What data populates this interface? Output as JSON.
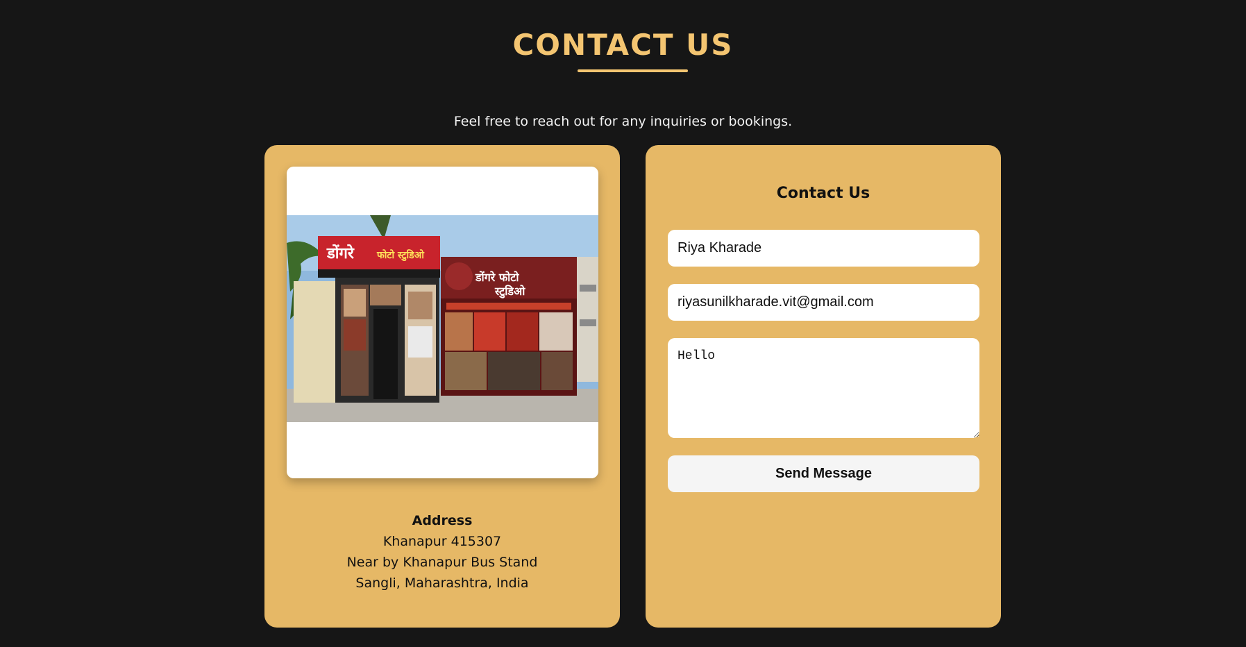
{
  "header": {
    "title": "CONTACT US",
    "subtitle": "Feel free to reach out for any inquiries or bookings."
  },
  "colors": {
    "page_background": "#161616",
    "accent": "#f4c571",
    "card_background": "#e6b866",
    "field_background": "#ffffff"
  },
  "address_card": {
    "photo": {
      "icon": "studio-storefront-photo",
      "banner_left": "डोंगरे फोटो स्टुडिओ",
      "banner_right": "डोंगरे फोटो स्टुडिओ"
    },
    "title": "Address",
    "lines": [
      "Khanapur 415307",
      "Near by Khanapur Bus Stand",
      "Sangli, Maharashtra, India"
    ]
  },
  "contact_form": {
    "title": "Contact Us",
    "name_value": "Riya Kharade",
    "email_value": "riyasunilkharade.vit@gmail.com",
    "message_value": "Hello",
    "send_label": "Send Message"
  }
}
